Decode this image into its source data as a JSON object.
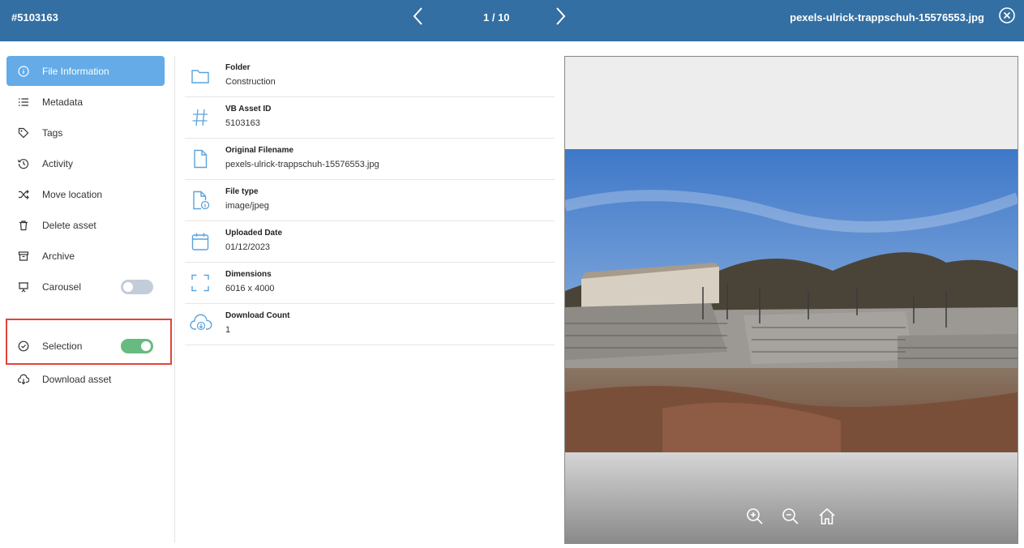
{
  "header": {
    "asset_id": "#5103163",
    "pager": "1 / 10",
    "filename": "pexels-ulrick-trappschuh-15576553.jpg"
  },
  "sidebar": {
    "items": [
      {
        "label": "File Information",
        "icon": "info-icon",
        "active": true
      },
      {
        "label": "Metadata",
        "icon": "list-icon"
      },
      {
        "label": "Tags",
        "icon": "tag-icon"
      },
      {
        "label": "Activity",
        "icon": "history-icon"
      },
      {
        "label": "Move location",
        "icon": "shuffle-icon"
      },
      {
        "label": "Delete asset",
        "icon": "trash-icon"
      },
      {
        "label": "Archive",
        "icon": "archive-icon"
      },
      {
        "label": "Carousel",
        "icon": "presentation-icon",
        "toggle": "off"
      },
      {
        "label": "Selection",
        "icon": "check-circle-icon",
        "toggle": "on"
      },
      {
        "label": "Download asset",
        "icon": "cloud-download-icon"
      }
    ]
  },
  "file_info": [
    {
      "label": "Folder",
      "value": "Construction",
      "icon": "folder-icon"
    },
    {
      "label": "VB Asset ID",
      "value": "5103163",
      "icon": "hash-icon"
    },
    {
      "label": "Original Filename",
      "value": "pexels-ulrick-trappschuh-15576553.jpg",
      "icon": "file-icon"
    },
    {
      "label": "File type",
      "value": "image/jpeg",
      "icon": "file-info-icon"
    },
    {
      "label": "Uploaded Date",
      "value": "01/12/2023",
      "icon": "calendar-icon"
    },
    {
      "label": "Dimensions",
      "value": "6016 x 4000",
      "icon": "dimensions-icon"
    },
    {
      "label": "Download Count",
      "value": "1",
      "icon": "cloud-download-icon"
    }
  ],
  "colors": {
    "header": "#336fa3",
    "active_item": "#64abe8",
    "toggle_on": "#66bb7e",
    "toggle_off": "#c3cdd9",
    "icon_blue": "#5ba3dc",
    "highlight": "#e2443b"
  },
  "preview": {
    "tools": [
      "zoom-in-icon",
      "zoom-out-icon",
      "home-icon"
    ]
  }
}
